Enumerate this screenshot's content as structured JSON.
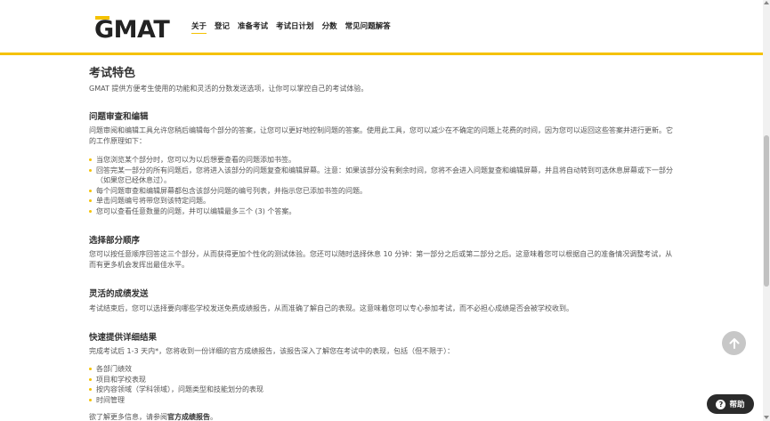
{
  "header": {
    "logo_text": "GMAT",
    "nav": [
      "关于",
      "登记",
      "准备考试",
      "考试日计划",
      "分数",
      "常见问题解答"
    ]
  },
  "page": {
    "title": "考试特色",
    "intro": "GMAT 提供方便考生使用的功能和灵活的分数发送选项，让你可以掌控自己的考试体验。",
    "sections": [
      {
        "heading": "问题审查和编辑",
        "text": "问题审阅和编辑工具允许您稍后编辑每个部分的答案，让您可以更好地控制问题的答案。使用此工具，您可以减少在不确定的问题上花费的时间，因为您可以返回这些答案并进行更新。它的工作原理如下：",
        "bullets": [
          "当您浏览某个部分时，您可以为以后想要查看的问题添加书签。",
          "回答完某一部分的所有问题后，您将进入该部分的问题复查和编辑屏幕。注意：如果该部分没有剩余时间，您将不会进入问题复查和编辑屏幕，并且将自动转到可选休息屏幕或下一部分（如果您已经休息过）。",
          "每个问题审查和编辑屏幕都包含该部分问题的编号列表，并指示您已添加书签的问题。",
          "单击问题编号将带您到该特定问题。",
          "您可以查看任意数量的问题，并可以编辑最多三个 (3) 个答案。"
        ]
      },
      {
        "heading": "选择部分顺序",
        "text": "您可以按任意顺序回答这三个部分，从而获得更加个性化的测试体验。您还可以随时选择休息 10 分钟：第一部分之后或第二部分之后。这意味着您可以根据自己的准备情况调整考试，从而有更多机会发挥出最佳水平。"
      },
      {
        "heading": "灵活的成绩发送",
        "text": "考试结束后，您可以选择要向哪些学校发送免费成绩报告，从而准确了解自己的表现。这意味着您可以专心参加考试，而不必担心成绩是否会被学校收到。"
      },
      {
        "heading": "快速提供详细结果",
        "text": "完成考试后 1-3 天内*，您将收到一份详细的官方成绩报告，该报告深入了解您在考试中的表现，包括（但不限于）：",
        "bullets": [
          "各部门绩效",
          "项目和学校表现",
          "按内容领域（学科领域），问题类型和技能划分的表现",
          "时间管理"
        ]
      }
    ],
    "footer_text": "欲了解更多信息，请参阅",
    "footer_link": "官方成绩报告",
    "footer_end": "。"
  },
  "widgets": {
    "help_label": "帮助",
    "help_icon": "question-icon",
    "back_to_top_icon": "arrow-up-icon"
  },
  "colors": {
    "accent": "#f5c200",
    "help_bg": "#2b2b2b"
  }
}
